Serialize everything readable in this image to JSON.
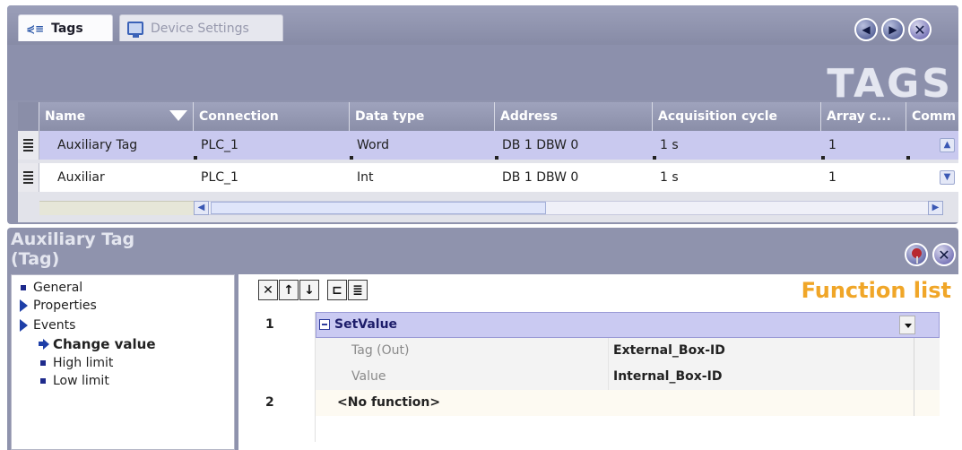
{
  "tabs": [
    {
      "label": "Tags",
      "active": true,
      "icon": "tag-list-icon"
    },
    {
      "label": "Device Settings",
      "active": false,
      "icon": "monitor-icon"
    }
  ],
  "editor": {
    "heading": "TAGS",
    "nav_prev_icon": "arrow-left-icon",
    "nav_next_icon": "arrow-right-icon",
    "close_icon": "close-icon"
  },
  "grid": {
    "columns": [
      "Name",
      "Connection",
      "Data type",
      "Address",
      "Acquisition cycle",
      "Array c...",
      "Comm"
    ],
    "rows": [
      {
        "name": "Auxiliary Tag",
        "connection": "PLC_1",
        "data_type": "Word",
        "address": "DB 1 DBW 0",
        "acquisition_cycle": "1 s",
        "array_count": "1",
        "selected": true
      },
      {
        "name": "Auxiliar",
        "connection": "PLC_1",
        "data_type": "Int",
        "address": "DB 1 DBW 0",
        "acquisition_cycle": "1 s",
        "array_count": "1",
        "selected": false
      }
    ]
  },
  "properties": {
    "title_line1": "Auxiliary Tag",
    "title_line2": "(Tag)",
    "pin_icon": "pin-icon",
    "close_icon": "close-icon",
    "nav": {
      "general": "General",
      "properties": "Properties",
      "events": "Events",
      "change_value": "Change value",
      "high_limit": "High limit",
      "low_limit": "Low limit"
    }
  },
  "function_list": {
    "title": "Function list",
    "toolbar": [
      "delete-icon",
      "move-up-icon",
      "move-down-icon",
      "collapse-all-icon",
      "expand-all-icon"
    ],
    "rows": [
      {
        "number": "1",
        "function": "SetValue",
        "params": [
          {
            "name": "Tag (Out)",
            "value": "External_Box-ID"
          },
          {
            "name": "Value",
            "value": "Internal_Box-ID"
          }
        ]
      },
      {
        "number": "2",
        "function": "<No function>"
      }
    ]
  },
  "colors": {
    "panel_bg": "#8f93ad",
    "selected_row": "#c9c9ef",
    "function_title": "#f0a628"
  }
}
